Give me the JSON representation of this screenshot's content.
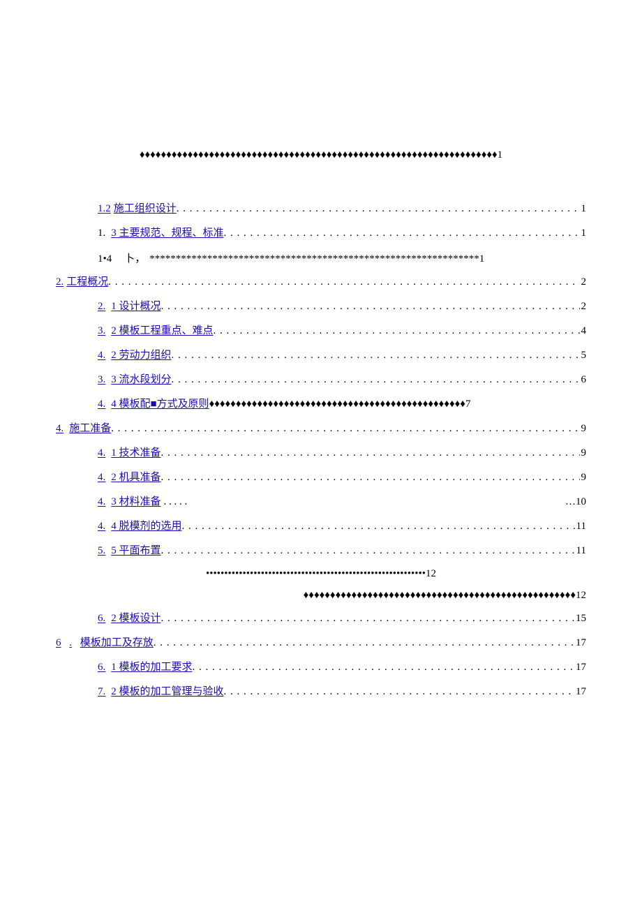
{
  "toc": {
    "top_fill_diamonds": "♦♦♦♦♦♦♦♦♦♦♦♦♦♦♦♦♦♦♦♦♦♦♦♦♦♦♦♦♦♦♦♦♦♦♦♦♦♦♦♦♦♦♦♦♦♦♦♦♦♦♦♦♦♦♦♦♦♦♦♦♦♦♦♦♦♦♦1",
    "line_1_2": {
      "num": "1.2",
      "text": "施工组织设计",
      "page": "1"
    },
    "line_1_3": {
      "num_prefix": "1.",
      "num_link": "3",
      "text": "主要规范、规程、标准",
      "page": "1"
    },
    "line_1_4": {
      "num": "1•4",
      "mid": "卜，",
      "fill": "***************************************************************1"
    },
    "line_2": {
      "num": "2.",
      "text": "工程概况",
      "page": "2"
    },
    "line_2_1": {
      "num": "2.",
      "text": "1 设计概况",
      "page": "2"
    },
    "line_3_2a": {
      "num": "3.",
      "text": "2 模板工程重点、难点",
      "page": "4"
    },
    "line_4_2a": {
      "num": "4.",
      "text": "2 劳动力组织",
      "page": "5"
    },
    "line_3_3": {
      "num": "3.",
      "text": "3 流水段划分",
      "page": "6"
    },
    "line_4_4a": {
      "num": "4.",
      "text": "4 模板配■方式及原则",
      "fill": "♦♦♦♦♦♦♦♦♦♦♦♦♦♦♦♦♦♦♦♦♦♦♦♦♦♦♦♦♦♦♦♦♦♦♦♦♦♦♦♦♦♦♦♦♦♦♦♦7"
    },
    "line_4": {
      "num": "4.",
      "text": "施工准备",
      "page": "9"
    },
    "line_4_1": {
      "num": "4.",
      "text": "1 技术准备",
      "page": "9"
    },
    "line_4_2b": {
      "num": "4.",
      "text": "2 机具准备",
      "page": "9"
    },
    "line_4_3": {
      "num": "4.",
      "text": "3 材料准备",
      "trail_left": ". . . . .",
      "trail_right": "…10"
    },
    "line_4_4b": {
      "num": "4.",
      "text": "4 脱模剂的选用",
      "page": "11"
    },
    "line_5_5": {
      "num": "5.",
      "text": "5 平面布置",
      "page": "11"
    },
    "mid_fill_bullets": "••••••••••••••••••••••••••••••••••••••••••••••••••••••••••••12",
    "mid_fill_diamonds": "♦♦♦♦♦♦♦♦♦♦♦♦♦♦♦♦♦♦♦♦♦♦♦♦♦♦♦♦♦♦♦♦♦♦♦♦♦♦♦♦♦♦♦♦♦♦♦♦♦♦♦12",
    "line_6_2": {
      "num": "6.",
      "text": "2 模板设计",
      "page": "15"
    },
    "line_6": {
      "num": "6",
      "dot": ".",
      "text": "模板加工及存放",
      "page": "17"
    },
    "line_6_1": {
      "num": "6.",
      "text": "1 模板的加工要求",
      "page": "17"
    },
    "line_7_2": {
      "num": "7.",
      "text": "2 模板的加工管理与验收",
      "page": "17"
    }
  }
}
